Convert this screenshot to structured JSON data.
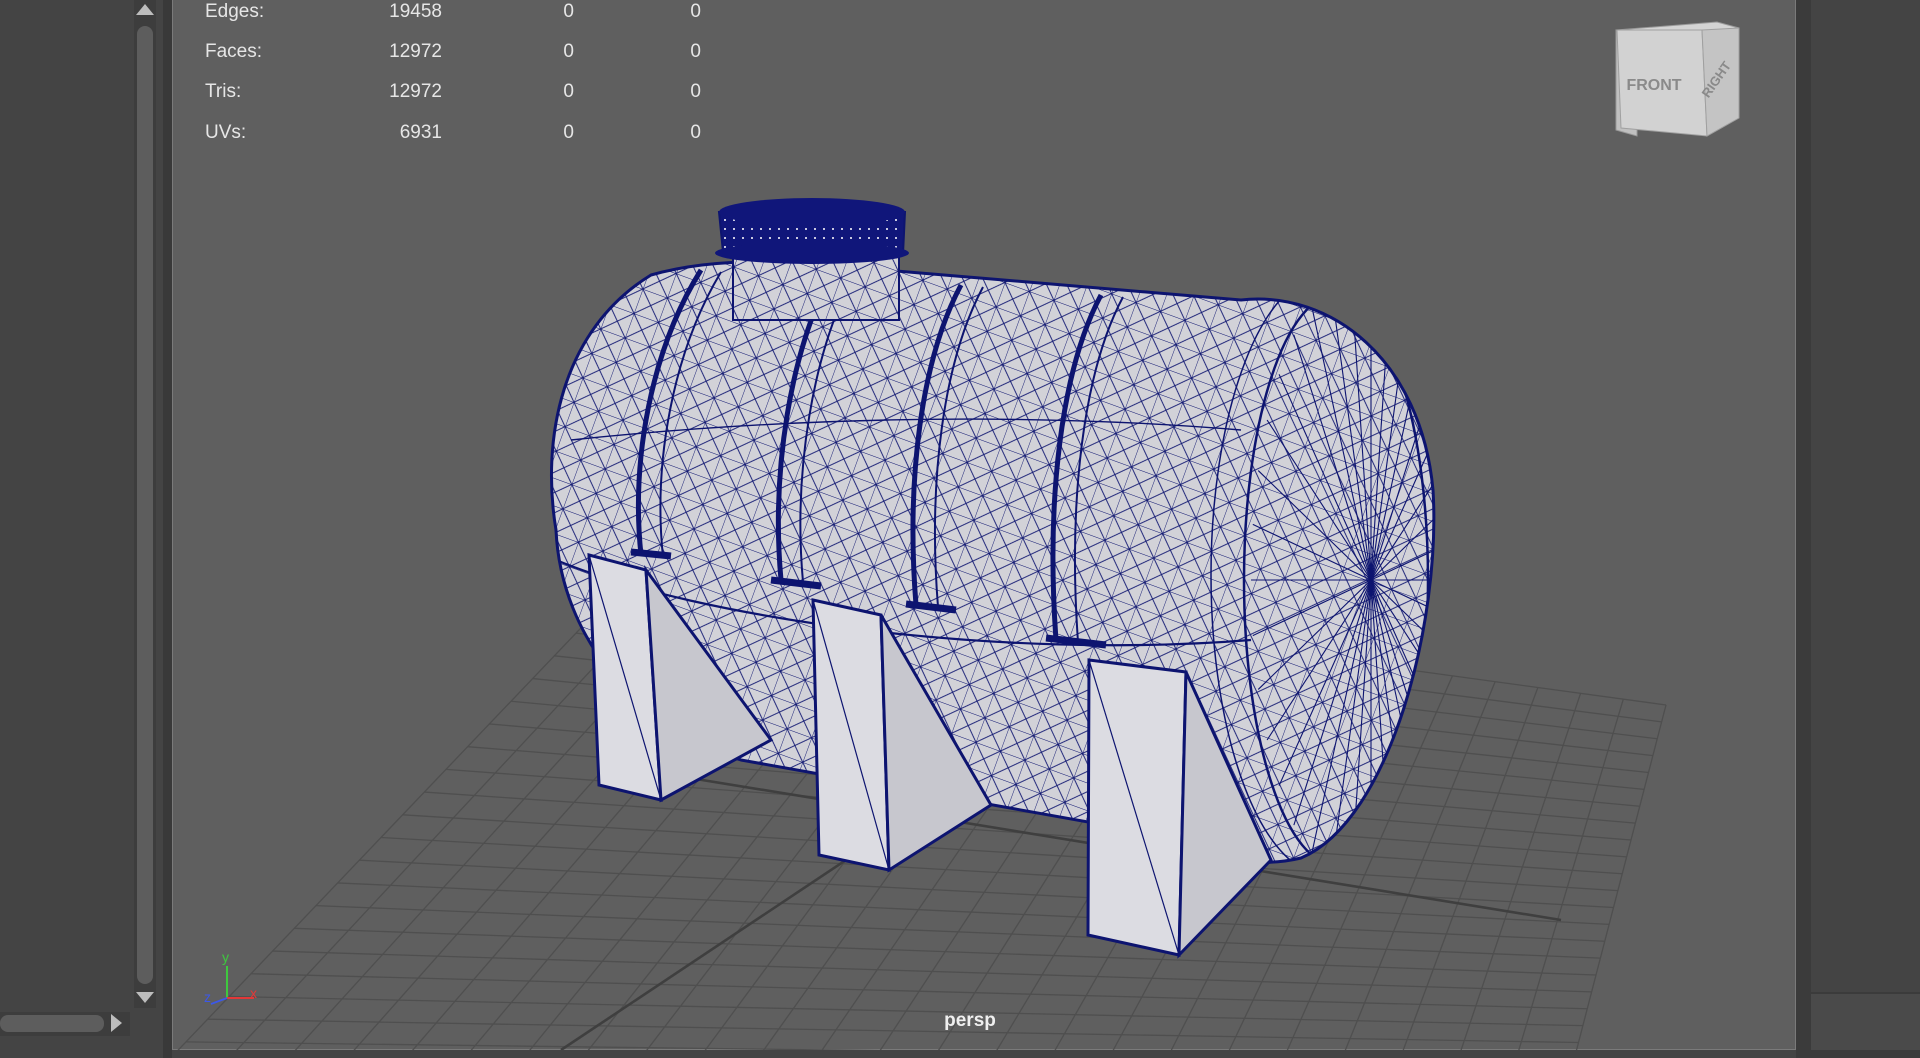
{
  "hud": {
    "rows": [
      {
        "label": "Edges:",
        "v1": "19458",
        "v2": "0",
        "v3": "0"
      },
      {
        "label": "Faces:",
        "v1": "12972",
        "v2": "0",
        "v3": "0"
      },
      {
        "label": "Tris:",
        "v1": "12972",
        "v2": "0",
        "v3": "0"
      },
      {
        "label": "UVs:",
        "v1": "6931",
        "v2": "0",
        "v3": "0"
      }
    ]
  },
  "viewcube": {
    "front_label": "FRONT",
    "right_label": "RIGHT"
  },
  "axis": {
    "y": "y",
    "z": "z",
    "x": "x"
  },
  "camera": {
    "name": "persp"
  },
  "colors": {
    "viewport_bg": "#5f5f5f",
    "grid_line": "#4f4f4f",
    "wireframe": "#0d1470",
    "mesh_fill": "#d2d2d8",
    "axis_y": "#3ec83e",
    "axis_x": "#e23838",
    "axis_z": "#3c58e8"
  }
}
